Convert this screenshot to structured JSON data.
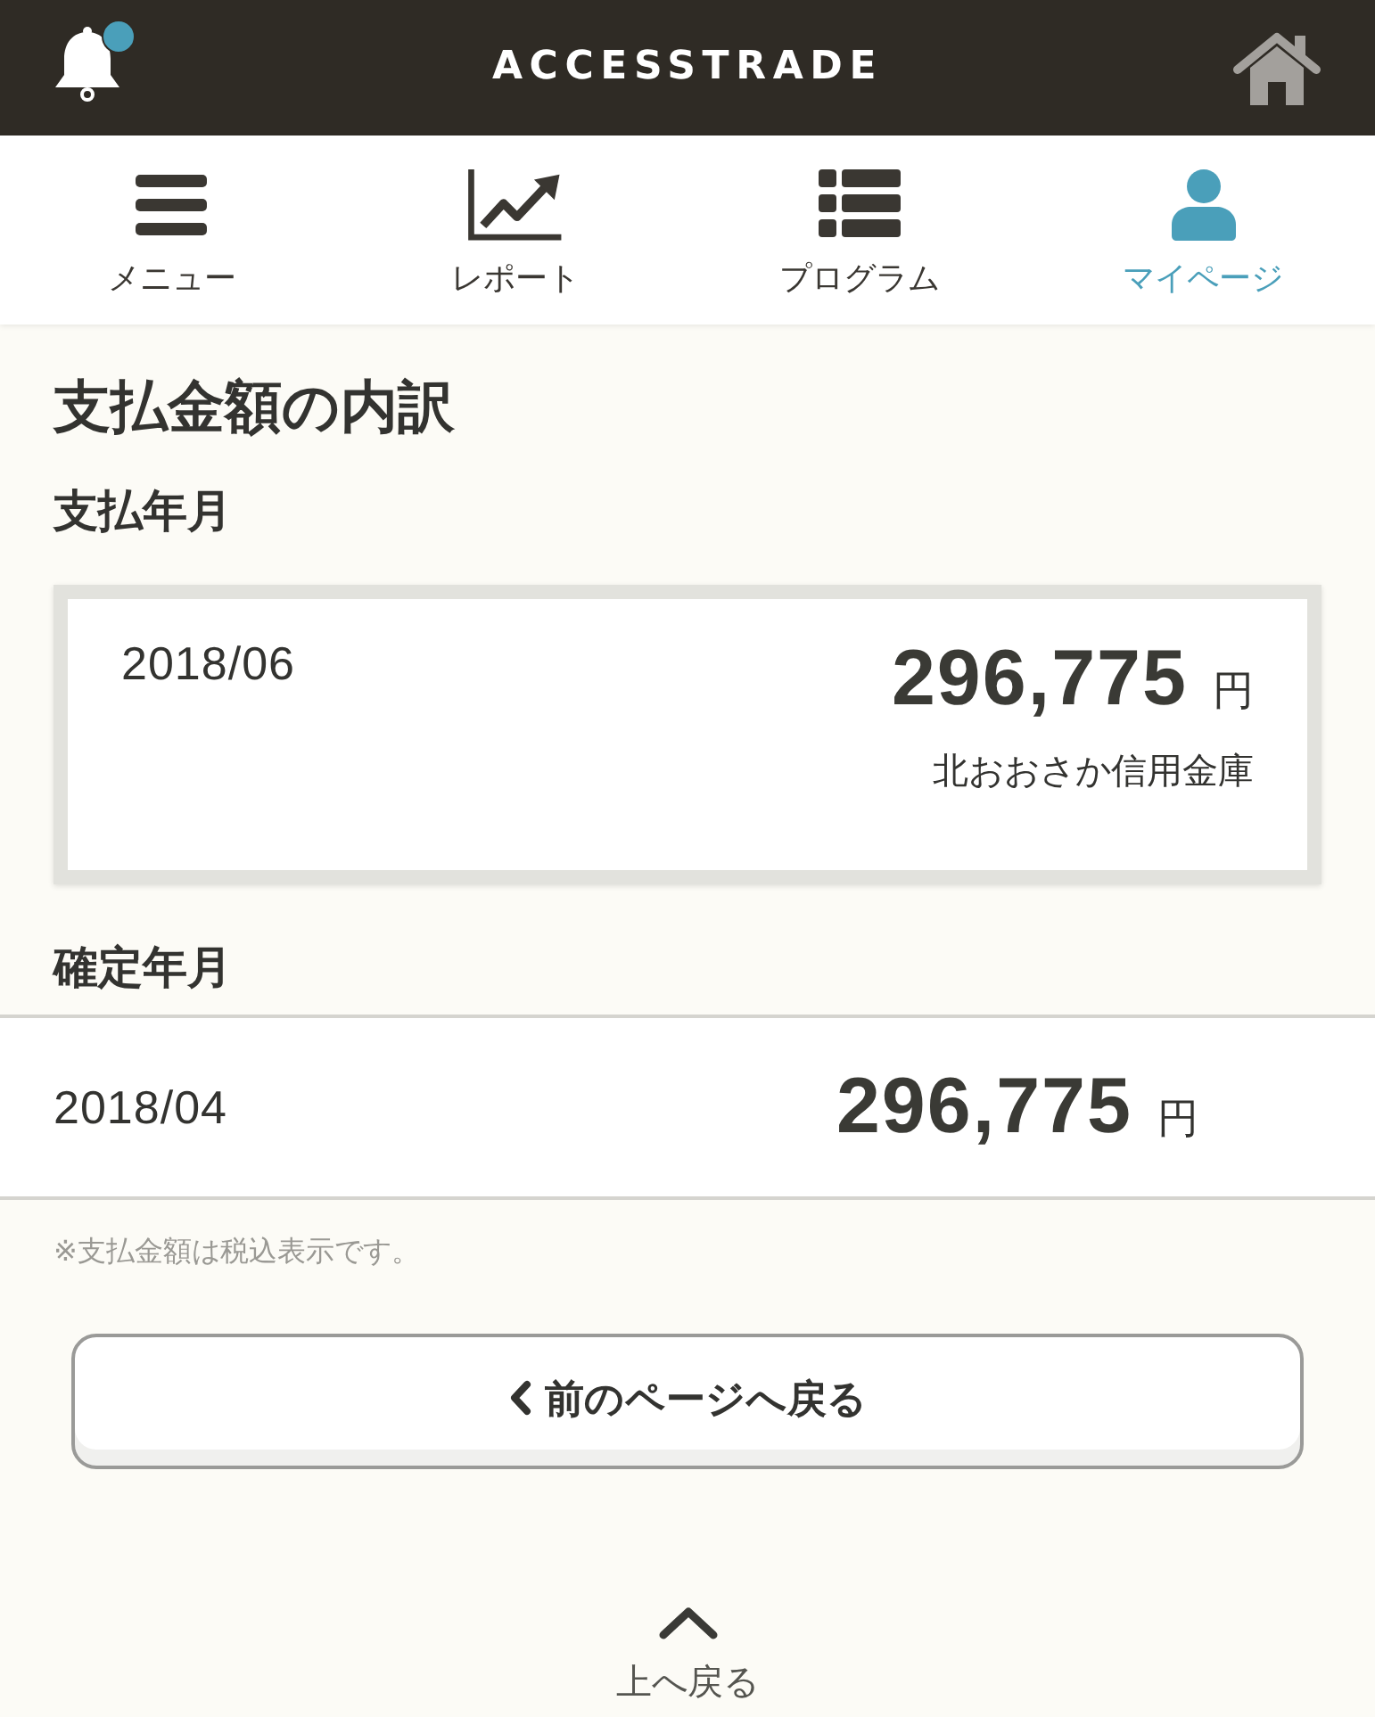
{
  "header": {
    "logo": "ACCESSTRADE",
    "unread_notifications": true
  },
  "tabs": [
    {
      "kind": "menu",
      "label": "メニュー",
      "selected": false
    },
    {
      "kind": "report",
      "label": "レポート",
      "selected": false
    },
    {
      "kind": "program",
      "label": "プログラム",
      "selected": false
    },
    {
      "kind": "mypage",
      "label": "マイページ",
      "selected": true
    }
  ],
  "page_title": "支払金額の内訳",
  "payment": {
    "heading": "支払年月",
    "month": "2018/06",
    "amount": "296,775",
    "currency": "円",
    "bank": "北おおさか信用金庫"
  },
  "confirmed": {
    "heading": "確定年月",
    "month": "2018/04",
    "amount": "296,775",
    "currency": "円"
  },
  "note": "※支払金額は税込表示です。",
  "back_button": "前のページへ戻る",
  "to_top": "上へ戻る"
}
